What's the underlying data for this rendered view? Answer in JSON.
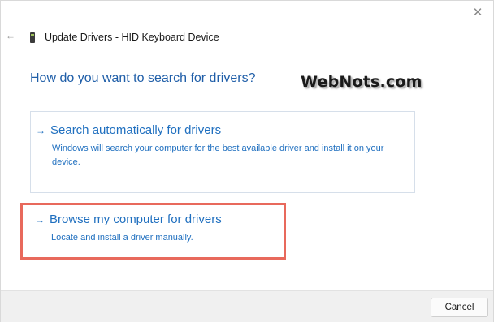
{
  "window": {
    "close_glyph": "✕",
    "back_glyph": "←",
    "title": "Update Drivers - HID Keyboard Device"
  },
  "heading": "How do you want to search for drivers?",
  "watermark": "WebNots.com",
  "options": [
    {
      "arrow": "→",
      "title": "Search automatically for drivers",
      "description": "Windows will search your computer for the best available driver and install it on your device."
    },
    {
      "arrow": "→",
      "title": "Browse my computer for drivers",
      "description": "Locate and install a driver manually.",
      "highlight_color": "#e8695c"
    }
  ],
  "footer": {
    "cancel_label": "Cancel"
  },
  "colors": {
    "accent": "#1f6fbf",
    "highlight": "#e8695c"
  }
}
